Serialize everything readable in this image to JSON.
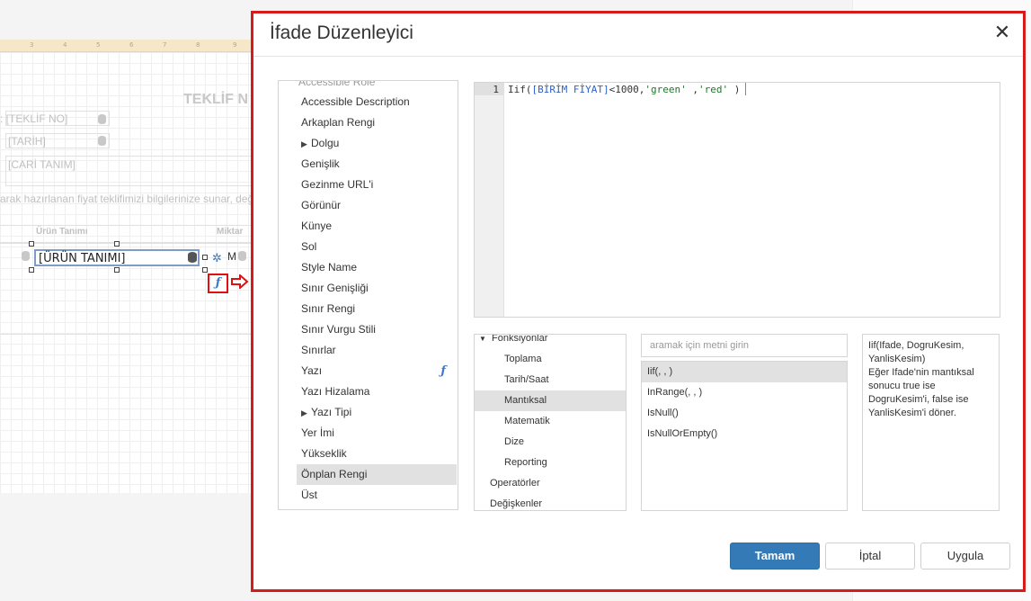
{
  "background": {
    "ruler_ticks": [
      "3",
      "4",
      "5",
      "6",
      "7",
      "8",
      "9"
    ],
    "report_title": "TEKLİF N",
    "teklif_field": ": [TEKLİF NO]",
    "tarih_field": "[TARİH]",
    "cari_field": "[CARİ TANIM]",
    "intro_text": "arak hazırlanan fiyat teklifimizi bilgilerinize sunar, değ",
    "column_urun": "Ürün Tanımı",
    "column_miktar": "Miktar",
    "urun_field": "[ÜRÜN TANIMI]",
    "miktar_cut": "M"
  },
  "dialog": {
    "title": "İfade Düzenleyici",
    "close_glyph": "✕"
  },
  "properties": {
    "cut_top": "Accessible Role",
    "items": [
      {
        "label": "Accessible Description"
      },
      {
        "label": "Arkaplan Rengi"
      },
      {
        "label": "Dolgu",
        "expandable": true
      },
      {
        "label": "Genişlik"
      },
      {
        "label": "Gezinme URL'i"
      },
      {
        "label": "Görünür"
      },
      {
        "label": "Künye"
      },
      {
        "label": "Sol"
      },
      {
        "label": "Style Name"
      },
      {
        "label": "Sınır Genişliği"
      },
      {
        "label": "Sınır Rengi"
      },
      {
        "label": "Sınır Vurgu Stili"
      },
      {
        "label": "Sınırlar"
      },
      {
        "label": "Yazı",
        "has_expression": true
      },
      {
        "label": "Yazı Hizalama"
      },
      {
        "label": "Yazı Tipi",
        "expandable": true
      },
      {
        "label": "Yer İmi"
      },
      {
        "label": "Yükseklik"
      },
      {
        "label": "Önplan Rengi",
        "selected": true
      },
      {
        "label": "Üst"
      }
    ]
  },
  "editor": {
    "line_number": "1",
    "code_text": "Iif([BİRİM FİYAT]<1000,'green' ,'red' )",
    "tokens": {
      "fn": "Iif(",
      "field": "[BİRİM FİYAT]",
      "op": "<1000,",
      "green": "'green'",
      "sep": " ,",
      "red": "'red'",
      "close": " )"
    }
  },
  "functions_tree": {
    "root": "Fonksiyonlar",
    "children": [
      "Toplama",
      "Tarih/Saat",
      "Mantıksal",
      "Matematik",
      "Dize",
      "Reporting"
    ],
    "selected": "Mantıksal",
    "other_roots": [
      "Operatörler",
      "Değişkenler"
    ]
  },
  "function_search": {
    "placeholder": "aramak için metni girin",
    "value": ""
  },
  "function_list": {
    "items": [
      "Iif(, , )",
      "InRange(, , )",
      "IsNull()",
      "IsNullOrEmpty()"
    ],
    "selected": "Iif(, , )"
  },
  "function_description": {
    "lines": [
      "Iif(Ifade, DogruKesim,",
      "YanlisKesim)",
      "Eğer Ifade'nin mantıksal",
      "sonucu true ise",
      "DogruKesim'i, false ise",
      "YanlisKesim'i döner."
    ]
  },
  "buttons": {
    "ok": "Tamam",
    "cancel": "İptal",
    "apply": "Uygula"
  },
  "icons": {
    "fx": "ƒ",
    "gear": "✲"
  },
  "colors": {
    "accent": "#337ab7",
    "highlight_border": "#d71a1a",
    "selection": "#e1e1e1",
    "code_field": "#2d62c7",
    "code_string": "#1a7a25"
  }
}
